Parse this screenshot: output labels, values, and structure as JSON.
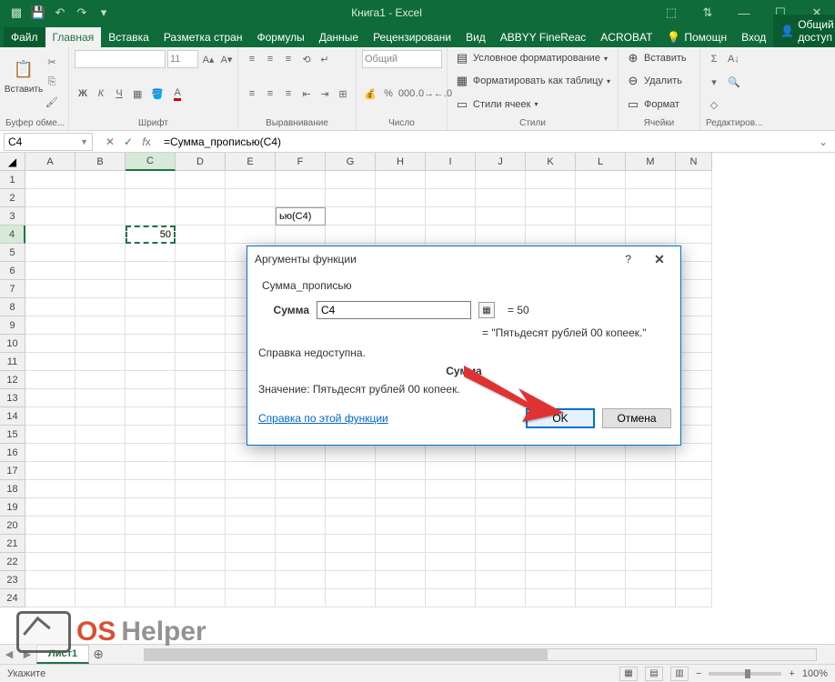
{
  "titlebar": {
    "title": "Книга1 - Excel"
  },
  "tabs": {
    "file": "Файл",
    "items": [
      "Главная",
      "Вставка",
      "Разметка стран",
      "Формулы",
      "Данные",
      "Рецензировани",
      "Вид",
      "ABBYY FineReac",
      "ACROBAT"
    ],
    "help": "Помощн",
    "signin": "Вход",
    "share": "Общий доступ"
  },
  "ribbon": {
    "clipboard": {
      "paste": "Вставить",
      "label": "Буфер обме..."
    },
    "font": {
      "name": "",
      "size": "11",
      "bold": "Ж",
      "italic": "К",
      "underline": "Ч",
      "label": "Шрифт"
    },
    "align": {
      "label": "Выравнивание"
    },
    "number": {
      "format": "Общий",
      "label": "Число"
    },
    "styles": {
      "cond": "Условное форматирование",
      "table": "Форматировать как таблицу",
      "cell": "Стили ячеек",
      "label": "Стили"
    },
    "cells": {
      "insert": "Вставить",
      "delete": "Удалить",
      "format": "Формат",
      "label": "Ячейки"
    },
    "editing": {
      "label": "Редактиров..."
    }
  },
  "formula": {
    "namebox": "C4",
    "formula": "=Сумма_прописью(C4)"
  },
  "grid": {
    "cols": [
      "A",
      "B",
      "C",
      "D",
      "E",
      "F",
      "G",
      "H",
      "I",
      "J",
      "K",
      "L",
      "M",
      "N"
    ],
    "rows": 24,
    "c4": "50",
    "f3_edit": "ью(C4)"
  },
  "sheets": {
    "sheet1": "Лист1"
  },
  "status": {
    "mode": "Укажите",
    "zoom": "100%"
  },
  "dialog": {
    "title": "Аргументы функции",
    "help_btn": "?",
    "fn": "Сумма_прописью",
    "arg_label": "Сумма",
    "arg_value": "C4",
    "arg_eq": "= 50",
    "result_eq": "=  \"Пятьдесят рублей  00 копеек.\"",
    "help_na": "Справка недоступна.",
    "section": "Сумма",
    "value_line": "Значение:   Пятьдесят рублей  00 копеек.",
    "help_link": "Справка по этой функции",
    "ok": "OK",
    "cancel": "Отмена"
  },
  "watermark": {
    "a": "OS",
    "b": "Helper"
  }
}
